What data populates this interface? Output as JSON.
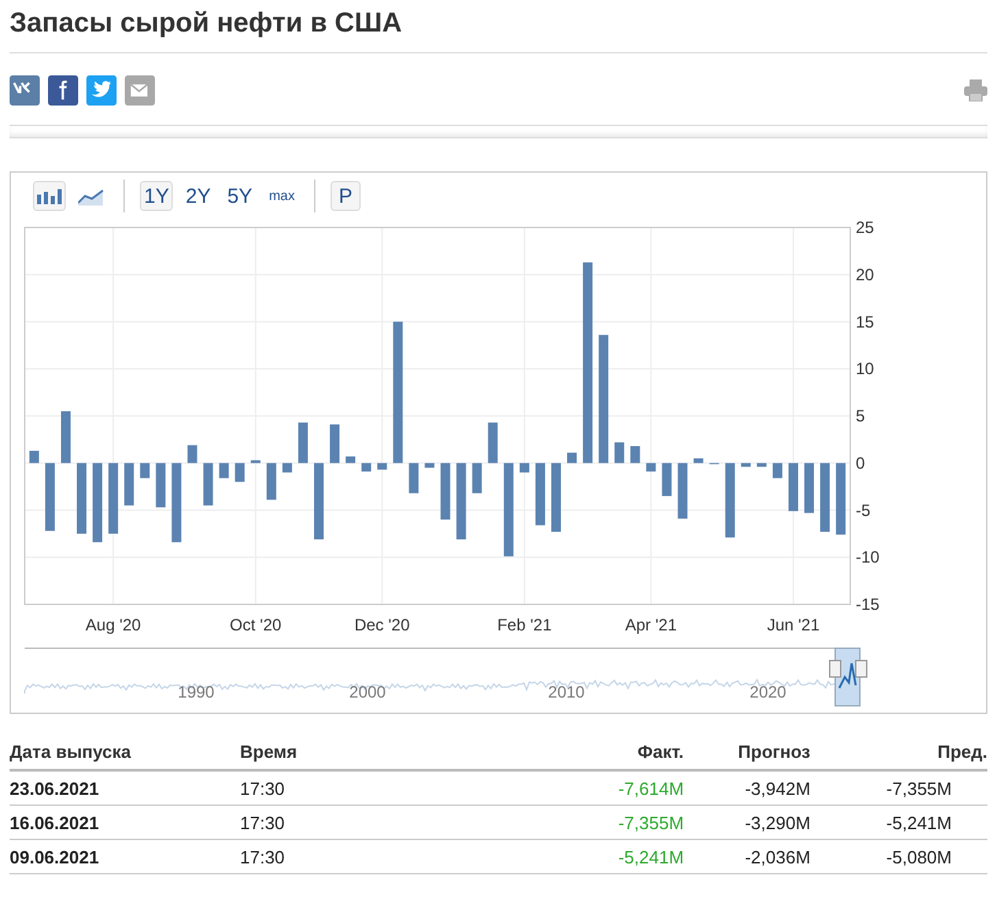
{
  "title": "Запасы сырой нефти в США",
  "share": [
    {
      "kind": "vk"
    },
    {
      "kind": "facebook"
    },
    {
      "kind": "twitter"
    },
    {
      "kind": "email"
    }
  ],
  "toolbar": {
    "chart_types": [
      {
        "kind": "bar",
        "selected": true
      },
      {
        "kind": "line",
        "selected": false
      }
    ],
    "periods": [
      {
        "label": "1Y",
        "selected": true
      },
      {
        "label": "2Y",
        "selected": false
      },
      {
        "label": "5Y",
        "selected": false
      },
      {
        "label": "max",
        "selected": false
      }
    ],
    "extra_button": "P"
  },
  "chart_data": {
    "type": "bar",
    "categories": [
      null,
      null,
      null,
      null,
      null,
      "Aug '20",
      null,
      null,
      null,
      null,
      null,
      null,
      null,
      null,
      "Oct '20",
      null,
      null,
      null,
      null,
      null,
      null,
      null,
      "Dec '20",
      null,
      null,
      null,
      null,
      null,
      null,
      null,
      null,
      "Feb '21",
      null,
      null,
      null,
      null,
      null,
      null,
      null,
      "Apr '21",
      null,
      null,
      null,
      null,
      null,
      null,
      null,
      null,
      "Jun '21",
      null,
      null,
      null
    ],
    "series": [
      {
        "color": "#5b83b1",
        "values": [
          1.3,
          -7.2,
          5.5,
          -7.5,
          -8.4,
          -7.5,
          -4.5,
          -1.6,
          -4.7,
          -8.4,
          1.9,
          -4.5,
          -1.6,
          -2.0,
          0.3,
          -3.9,
          -1.0,
          4.3,
          -8.1,
          4.1,
          0.7,
          -0.9,
          -0.7,
          15.0,
          -3.2,
          -0.5,
          -6.0,
          -8.1,
          -3.2,
          4.3,
          -9.9,
          -1.0,
          -6.6,
          -7.3,
          1.1,
          21.3,
          13.6,
          2.2,
          1.8,
          -0.9,
          -3.5,
          -5.9,
          0.5,
          -0.1,
          -7.9,
          -0.4,
          -0.4,
          -1.6,
          -5.1,
          -5.3,
          -7.3,
          -7.6
        ]
      }
    ],
    "ylim": [
      -15,
      25
    ],
    "grid": true,
    "yticks": [
      -15,
      -10,
      -5,
      0,
      5,
      10,
      15,
      20,
      25
    ]
  },
  "navigator": {
    "labels": [
      "1990",
      "2000",
      "2010",
      "2020"
    ]
  },
  "table": {
    "columns": [
      "Дата выпуска",
      "Время",
      "Факт.",
      "Прогноз",
      "Пред."
    ],
    "rows": [
      {
        "date": "23.06.2021",
        "time": "17:30",
        "actual": "-7,614M",
        "color": "#2daa2d",
        "forecast": "-3,942M",
        "previous": "-7,355M"
      },
      {
        "date": "16.06.2021",
        "time": "17:30",
        "actual": "-7,355M",
        "color": "#2daa2d",
        "forecast": "-3,290M",
        "previous": "-5,241M"
      },
      {
        "date": "09.06.2021",
        "time": "17:30",
        "actual": "-5,241M",
        "color": "#2daa2d",
        "forecast": "-2,036M",
        "previous": "-5,080M"
      }
    ]
  }
}
